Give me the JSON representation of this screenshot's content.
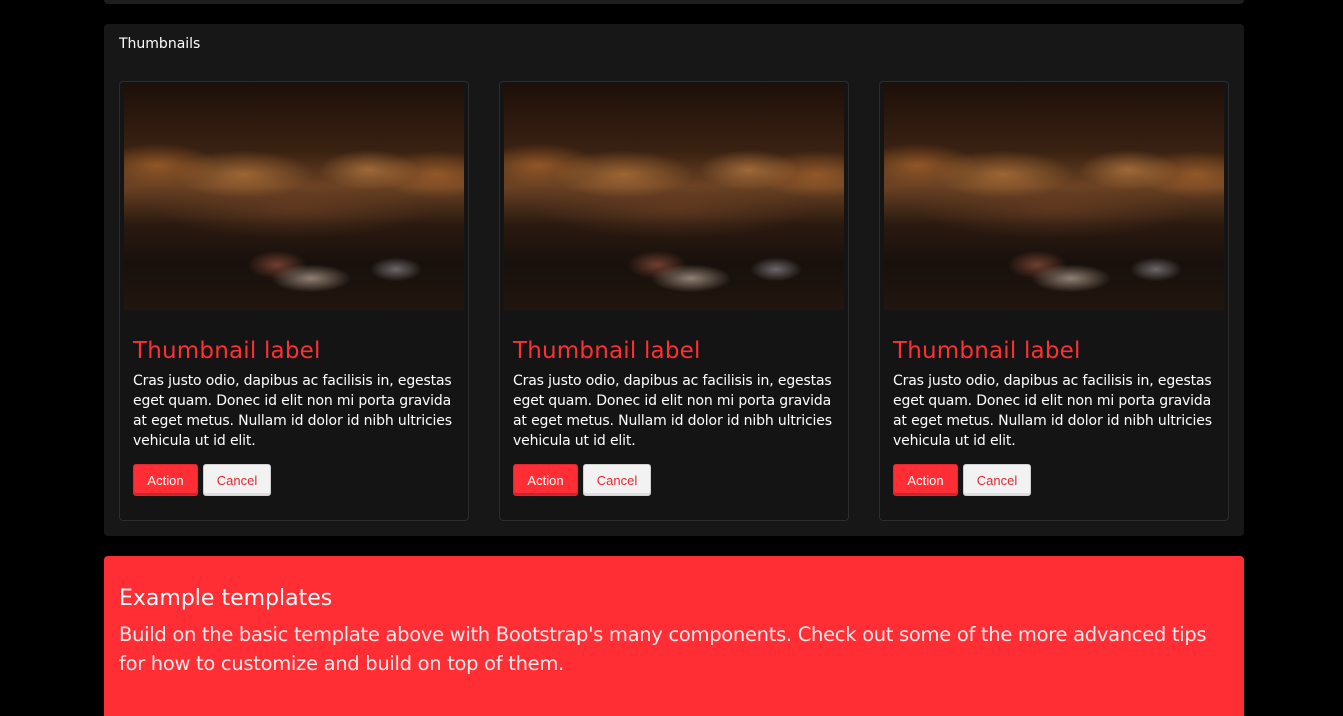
{
  "panel": {
    "title": "Thumbnails"
  },
  "thumbnails": [
    {
      "label": "Thumbnail label",
      "text": "Cras justo odio, dapibus ac facilisis in, egestas eget quam. Donec id elit non mi porta gravida at eget metus. Nullam id dolor id nibh ultricies vehicula ut id elit.",
      "action_label": "Action",
      "cancel_label": "Cancel"
    },
    {
      "label": "Thumbnail label",
      "text": "Cras justo odio, dapibus ac facilisis in, egestas eget quam. Donec id elit non mi porta gravida at eget metus. Nullam id dolor id nibh ultricies vehicula ut id elit.",
      "action_label": "Action",
      "cancel_label": "Cancel"
    },
    {
      "label": "Thumbnail label",
      "text": "Cras justo odio, dapibus ac facilisis in, egestas eget quam. Donec id elit non mi porta gravida at eget metus. Nullam id dolor id nibh ultricies vehicula ut id elit.",
      "action_label": "Action",
      "cancel_label": "Cancel"
    }
  ],
  "jumbotron": {
    "title": "Example templates",
    "text": "Build on the basic template above with Bootstrap's many components. Check out some of the more advanced tips for how to customize and build on top of them."
  },
  "colors": {
    "accent": "#ff2e35",
    "background": "#000000",
    "panel": "#171717"
  }
}
